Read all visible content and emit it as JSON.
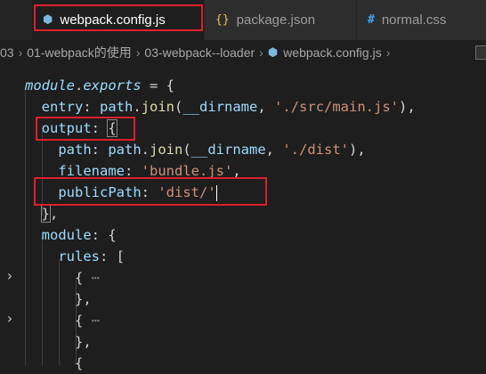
{
  "tabs": [
    {
      "label": "webpack.config.js",
      "icon": "webpack-icon",
      "active": true
    },
    {
      "label": "package.json",
      "icon": "json-icon",
      "active": false
    },
    {
      "label": "normal.css",
      "icon": "css-hash-icon",
      "active": false
    }
  ],
  "breadcrumb": [
    "03",
    "01-webpack的使用",
    "03-webpack--loader",
    "webpack.config.js",
    ""
  ],
  "code": {
    "l1_module": "module",
    "l1_exports": "exports",
    "l1_rest": " = {",
    "l2_entry": "entry",
    "l2_path": "path",
    "l2_join": "join",
    "l2_dirname": "__dirname",
    "l2_str": "'./src/main.js'",
    "l3_output": "output",
    "l4_path": "path",
    "l4_path2": "path",
    "l4_join": "join",
    "l4_dirname": "__dirname",
    "l4_str": "'./dist'",
    "l5_filename": "filename",
    "l5_str": "'bundle.js'",
    "l6_publicPath": "publicPath",
    "l6_str": "'dist/'",
    "l8_module": "module",
    "l9_rules": "rules",
    "collapsed_marker": "⋯"
  },
  "colors": {
    "highlight_box": "#e01e2b",
    "editor_bg": "#1e1e1e"
  }
}
